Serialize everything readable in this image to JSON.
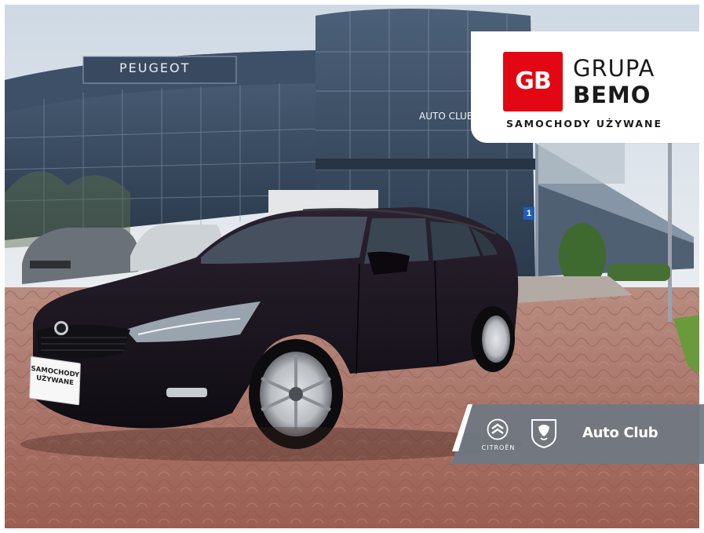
{
  "scene": {
    "colors": {
      "sky": "#dfe6ee",
      "glass": "#3a4d63",
      "pavement": "#a86a5c",
      "car_body": "#15111a",
      "brand_red": "#e30613",
      "banner": "#7a828c"
    }
  },
  "building_signage": {
    "brand": "PEUGEOT",
    "dealer": "AUTO CLUB",
    "door_number": "1"
  },
  "car_plate": {
    "line1": "SAMOCHODY",
    "line2": "UŻYWANE"
  },
  "logo": {
    "mark": "GB",
    "name_line1": "GRUPA",
    "name_line2": "BEMO",
    "tagline": "SAMOCHODY UŻYWANE",
    "icon": "gb-logo-mark"
  },
  "dealer_banner": {
    "brand1_icon": "citroen-chevrons-icon",
    "brand1_label": "CITROËN",
    "brand2_icon": "peugeot-lion-shield-icon",
    "label": "Auto Club"
  }
}
